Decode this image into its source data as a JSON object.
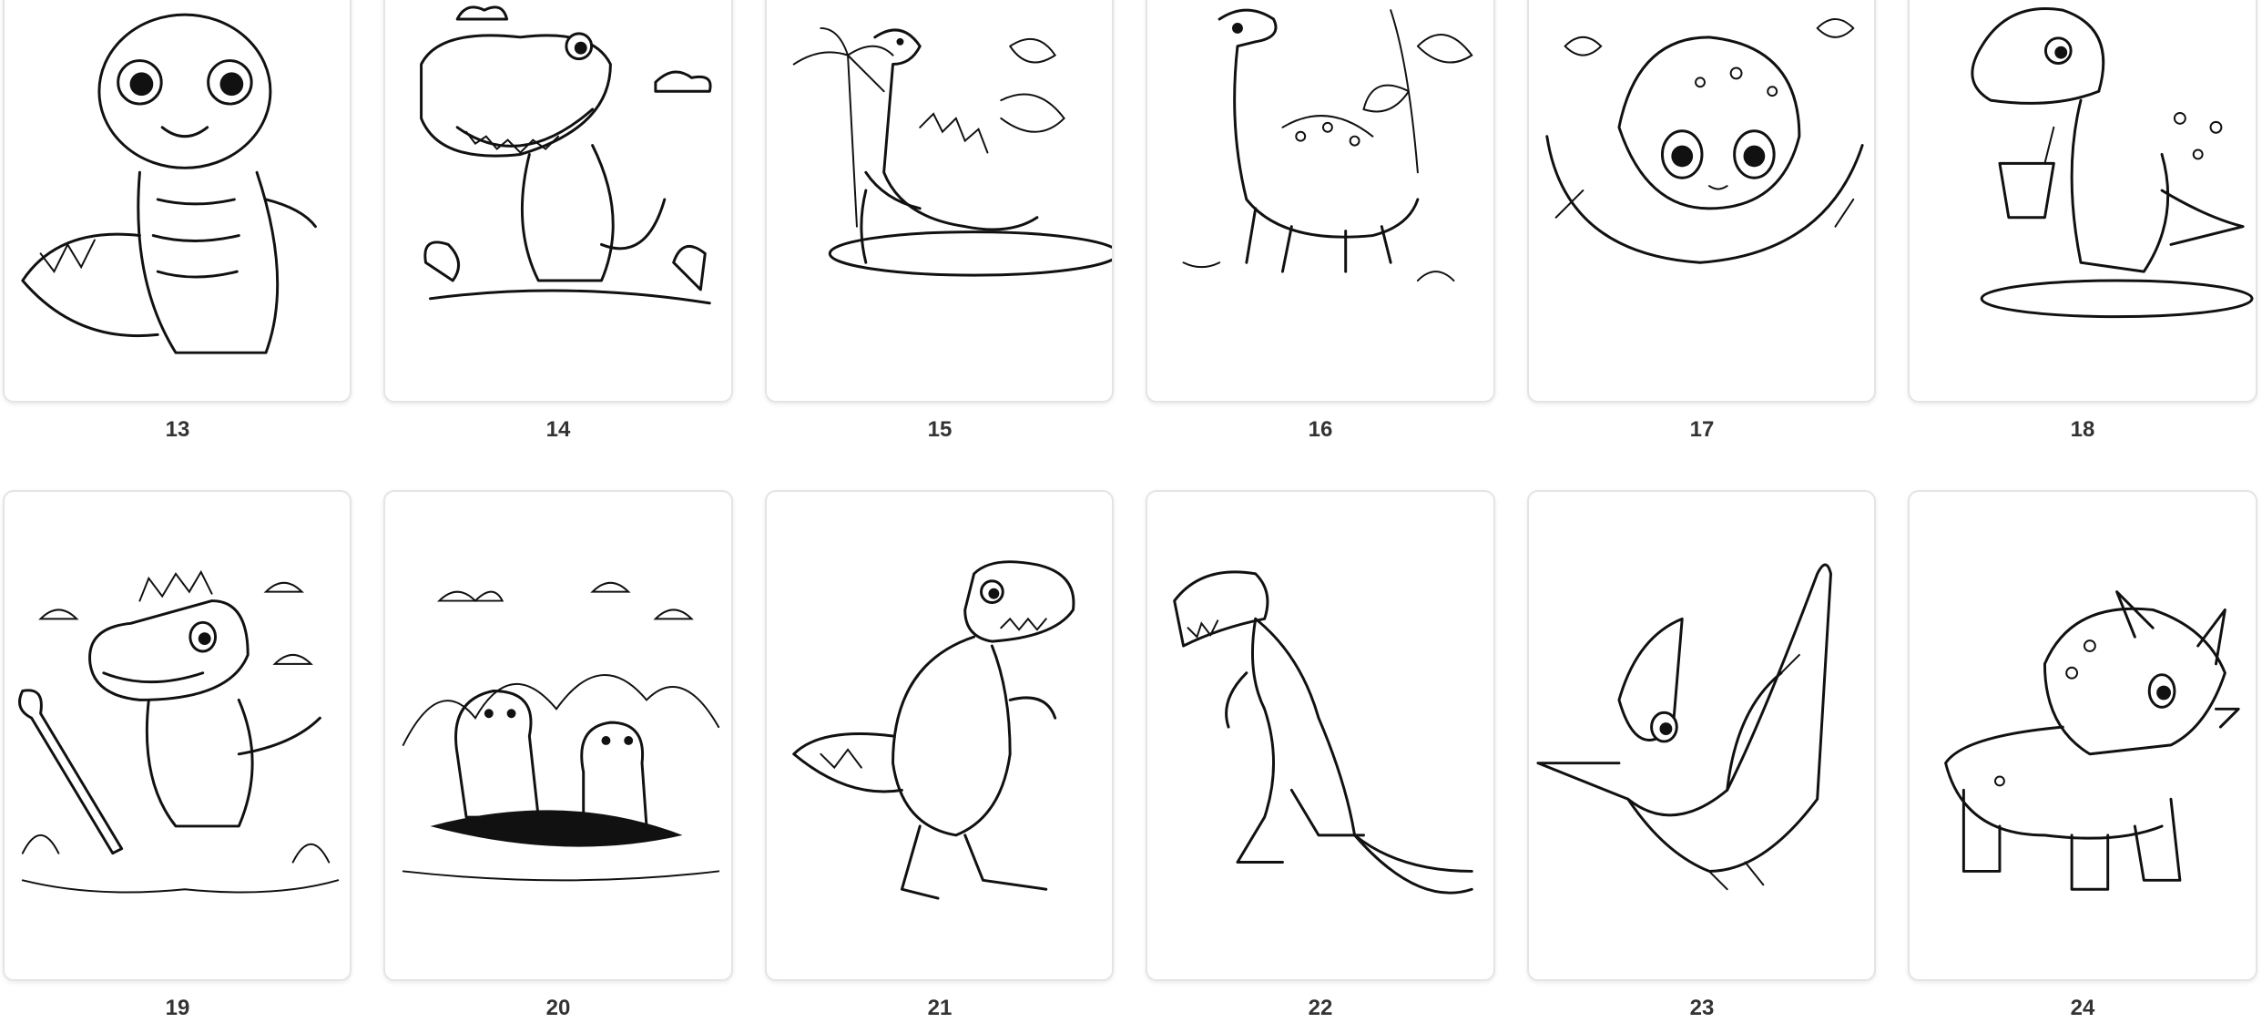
{
  "pages": [
    {
      "number": "13",
      "icon": "baby-dinosaur-sitting"
    },
    {
      "number": "14",
      "icon": "t-rex-smiling"
    },
    {
      "number": "15",
      "icon": "dinosaur-palm-trees"
    },
    {
      "number": "16",
      "icon": "long-neck-dinosaur"
    },
    {
      "number": "17",
      "icon": "dinosaur-in-nest"
    },
    {
      "number": "18",
      "icon": "dinosaur-with-cup"
    },
    {
      "number": "19",
      "icon": "dinosaur-with-shovel"
    },
    {
      "number": "20",
      "icon": "two-dinosaurs-mud"
    },
    {
      "number": "21",
      "icon": "t-rex-standing"
    },
    {
      "number": "22",
      "icon": "t-rex-roaring"
    },
    {
      "number": "23",
      "icon": "pterodactyl"
    },
    {
      "number": "24",
      "icon": "triceratops"
    }
  ]
}
